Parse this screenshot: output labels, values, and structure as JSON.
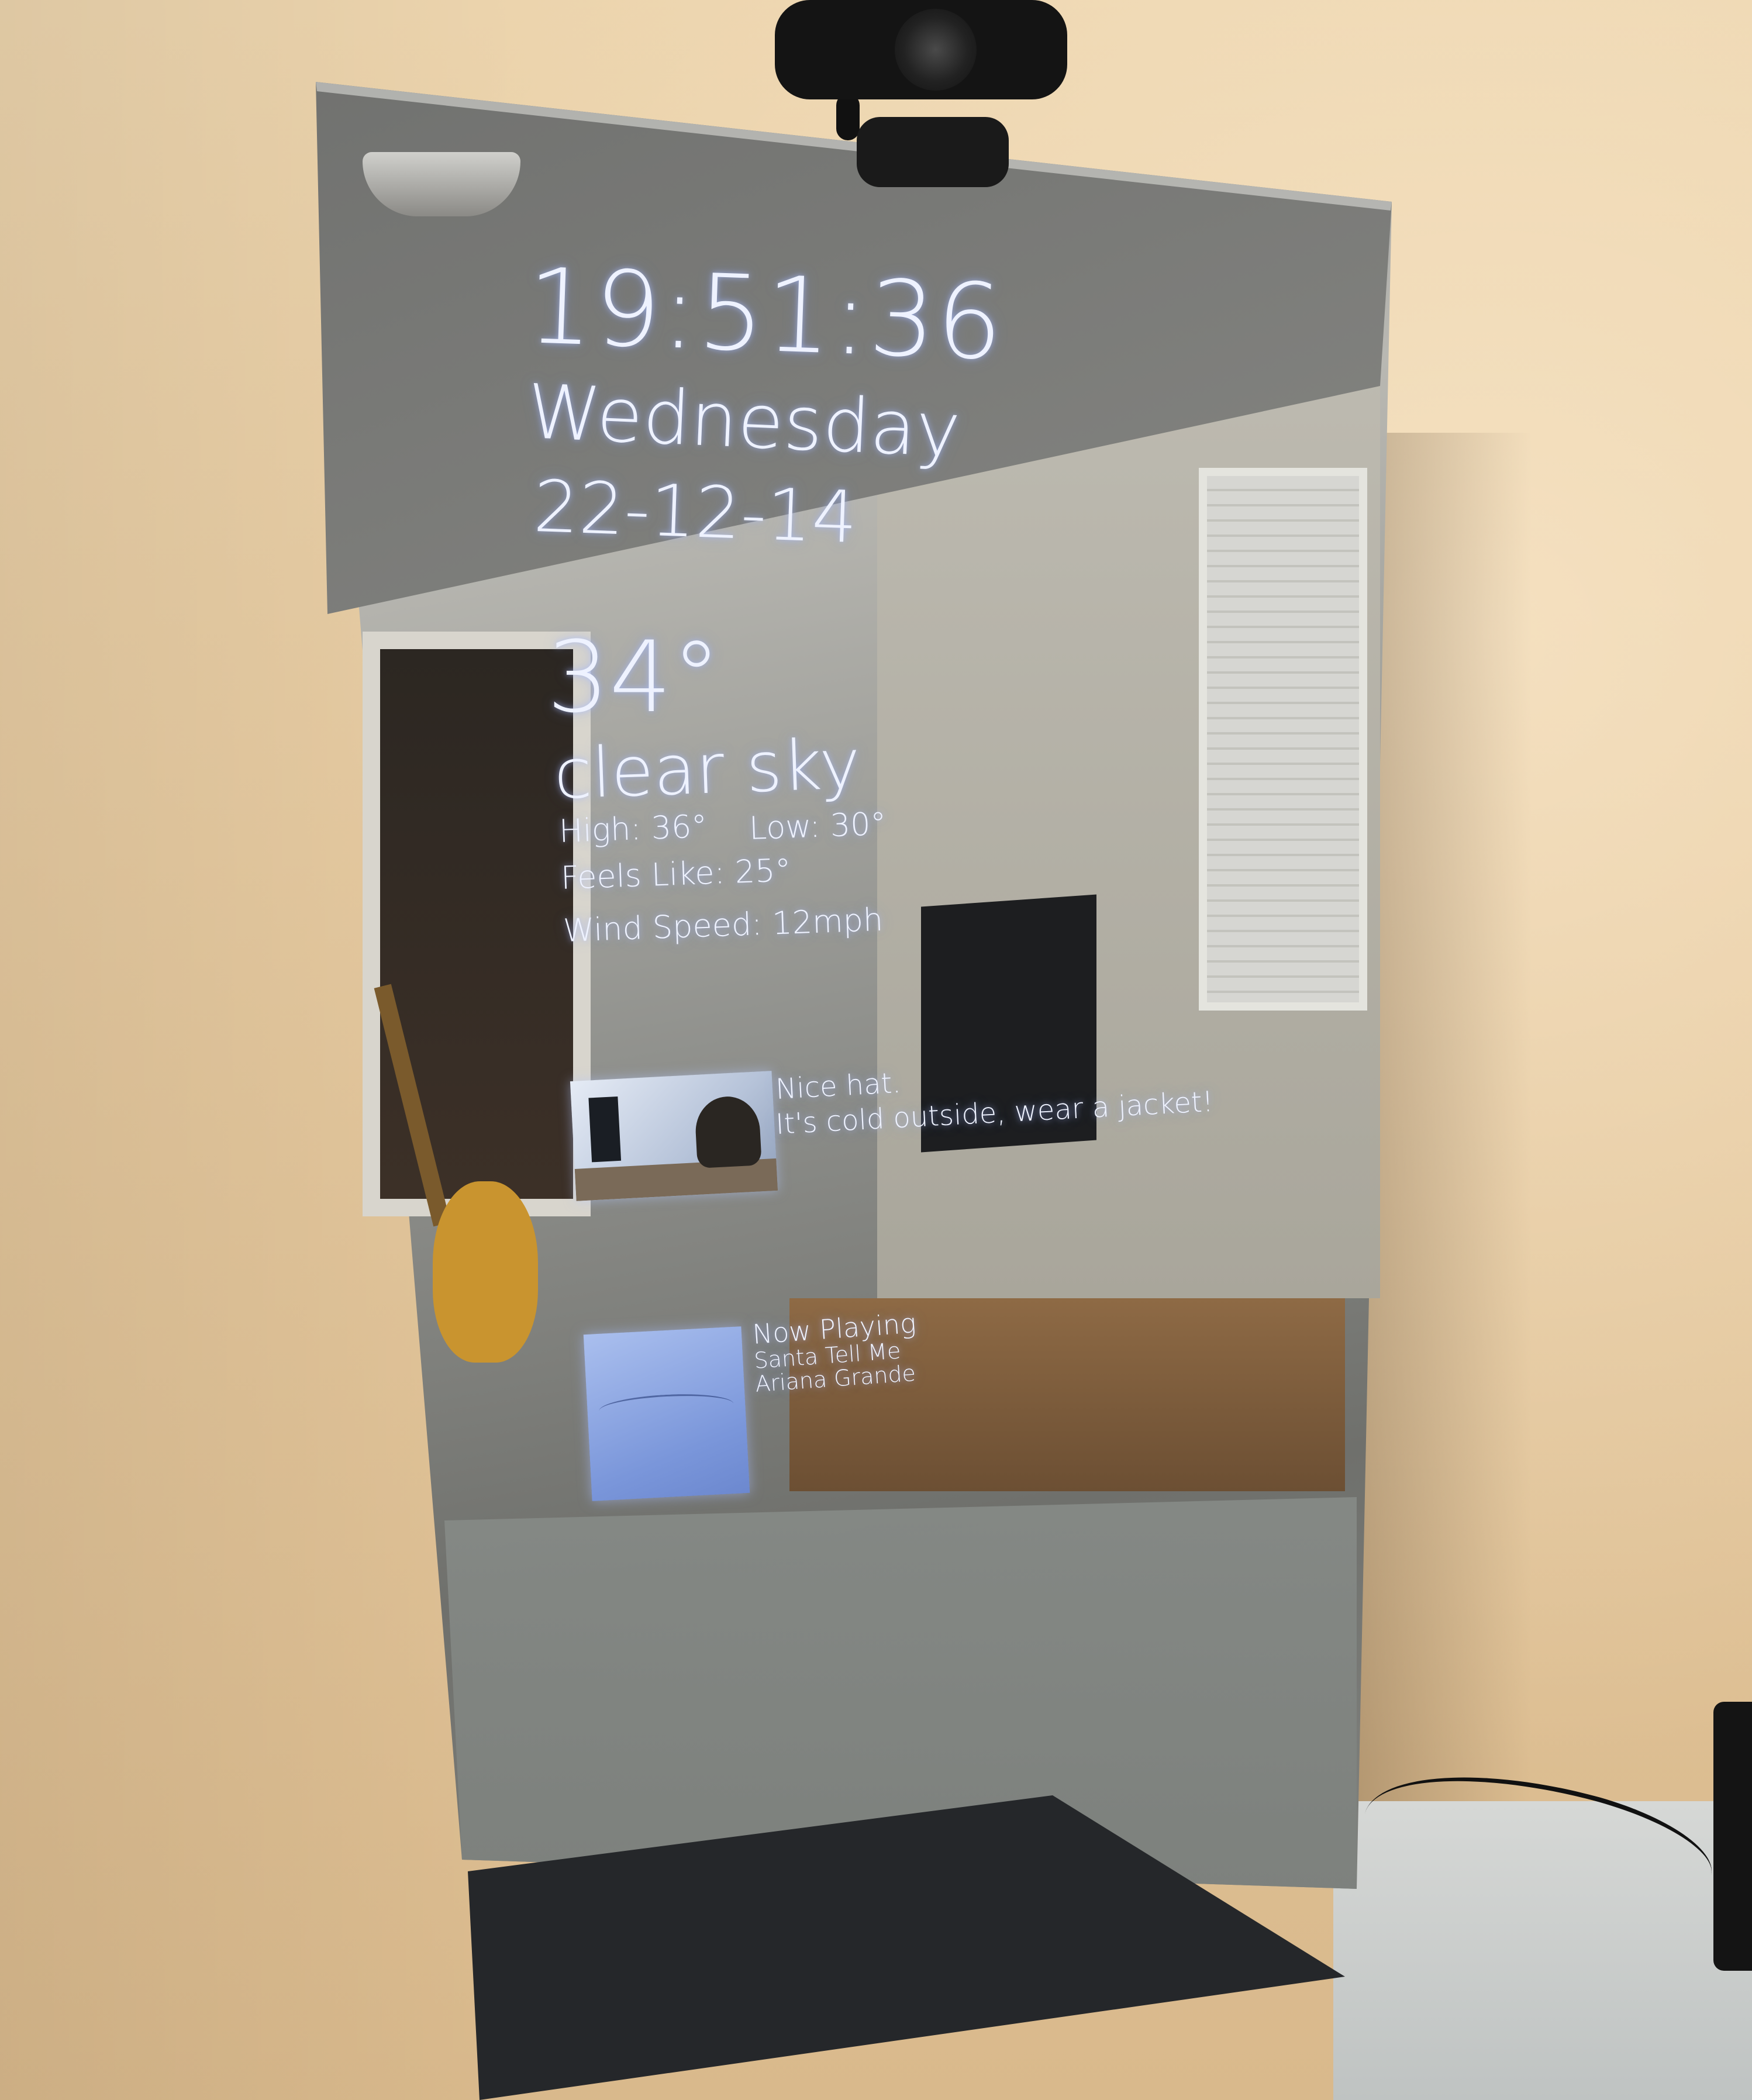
{
  "clock": {
    "time": "19:51:36",
    "day": "Wednesday",
    "date": "22-12-14"
  },
  "weather": {
    "temperature": "34°",
    "description": "clear sky",
    "high": "High: 36°",
    "low": "Low: 30°",
    "feels_like": "Feels Like: 25°",
    "wind_speed": "Wind Speed: 12mph"
  },
  "camera_message": {
    "line1": "Nice hat.",
    "line2": "It's cold outside, wear a jacket!"
  },
  "now_playing": {
    "label": "Now Playing",
    "title": "Santa Tell Me",
    "artist": "Ariana Grande"
  },
  "colors": {
    "overlay_text": "#eef2ff",
    "wall": "#e6caa0"
  }
}
